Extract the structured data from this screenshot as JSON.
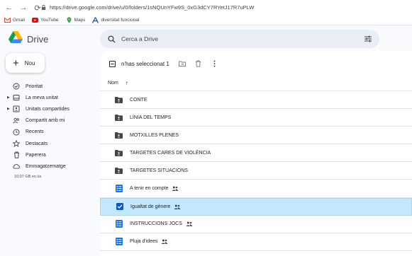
{
  "browser": {
    "url": "https://drive.google.com/drive/u/0/folders/1sNQUnYFw9S_0xG3dCY7RYetJ17R7uPLW",
    "bookmarks": [
      {
        "label": "Gmail",
        "icon": "gmail-icon"
      },
      {
        "label": "YouTube",
        "icon": "youtube-icon"
      },
      {
        "label": "Maps",
        "icon": "maps-icon"
      },
      {
        "label": "diversitat funcional",
        "icon": "a-logo-icon"
      }
    ]
  },
  "app": {
    "title": "Drive"
  },
  "new_button": {
    "label": "Nou"
  },
  "sidebar": {
    "items": [
      {
        "label": "Prioritat",
        "icon": "priority-icon",
        "expandable": false
      },
      {
        "label": "La meva unitat",
        "icon": "my-drive-icon",
        "expandable": true
      },
      {
        "label": "Unitats compartides",
        "icon": "shared-drives-icon",
        "expandable": true
      },
      {
        "label": "Compartit amb mi",
        "icon": "shared-with-me-icon",
        "expandable": false
      },
      {
        "label": "Recents",
        "icon": "recent-icon",
        "expandable": false
      },
      {
        "label": "Destacats",
        "icon": "star-icon",
        "expandable": false
      },
      {
        "label": "Paperera",
        "icon": "trash-icon",
        "expandable": false
      },
      {
        "label": "Emmagatzematge",
        "icon": "cloud-icon",
        "expandable": false
      }
    ],
    "storage_text": "10,07 GB en ús"
  },
  "search": {
    "placeholder": "Cerca a Drive"
  },
  "selection_bar": {
    "label": "n'has seleccionat 1"
  },
  "table": {
    "column_name": "Nom",
    "rows": [
      {
        "name": "CONTE",
        "type": "shared-folder",
        "shared": false,
        "selected": false
      },
      {
        "name": "LÍNIA DEL TEMPS",
        "type": "shared-folder",
        "shared": false,
        "selected": false
      },
      {
        "name": "MOTXILLES PLENES",
        "type": "shared-folder",
        "shared": false,
        "selected": false
      },
      {
        "name": "TARGETES CARES DE VIOLÈNCIA",
        "type": "shared-folder",
        "shared": false,
        "selected": false
      },
      {
        "name": "TARGETES SITUACIONS",
        "type": "shared-folder",
        "shared": false,
        "selected": false
      },
      {
        "name": "A tenir en compte",
        "type": "form",
        "shared": true,
        "selected": false
      },
      {
        "name": "Igualtat de gènere",
        "type": "form",
        "shared": true,
        "selected": true
      },
      {
        "name": "INSTRUCCIONS JOCS",
        "type": "form",
        "shared": true,
        "selected": false
      },
      {
        "name": "Pluja d'idees",
        "type": "form",
        "shared": true,
        "selected": false
      }
    ]
  },
  "colors": {
    "selected_row": "#c2e7ff",
    "search_bg": "#e9eef6",
    "page_bg": "#f8fafd",
    "form_blue": "#1a73e8"
  }
}
